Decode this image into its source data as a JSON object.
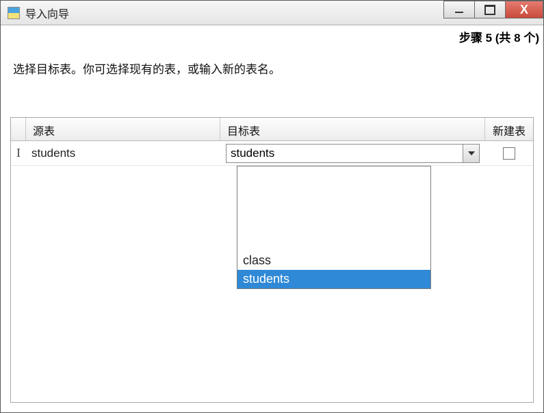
{
  "window": {
    "title": "导入向导"
  },
  "step": {
    "label": "步骤 5 (共 8 个)"
  },
  "instruction": "选择目标表。你可选择现有的表，或输入新的表名。",
  "columns": {
    "source": "源表",
    "target": "目标表",
    "newTable": "新建表"
  },
  "row": {
    "sourceValue": "students",
    "targetValue": "students"
  },
  "dropdown": {
    "options": [
      "class",
      "students"
    ],
    "option0": "class",
    "option1": "students",
    "selected": "students"
  },
  "icons": {
    "cursor": "I",
    "close": "X"
  }
}
